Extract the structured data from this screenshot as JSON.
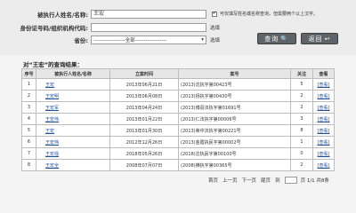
{
  "form": {
    "name_label": "被执行人姓名/名称:",
    "name_value": "王宏",
    "id_label": "身份证号码/组织机构代码:",
    "id_value": "",
    "id_hint": "选填",
    "province_label": "省份:",
    "province_value": "------------------全部------------------",
    "province_hint": "选填",
    "checkbox_mark": "✔",
    "checkbox_text": "可仅填写姓名或名称查询，但需要两个以上汉字。"
  },
  "buttons": {
    "search_label": "查询",
    "search_glyph": "🔍",
    "back_label": "返回",
    "back_glyph": "↩"
  },
  "results": {
    "title": "对“王宏”的查询结果：",
    "headers": [
      "序号",
      "被执行人姓名/名称",
      "立案时间",
      "案号",
      "关注",
      "查看"
    ],
    "rows": [
      [
        "1",
        "王宏",
        "2013年06月21日",
        "(2013)沈执字第00423号",
        "5",
        "[查看]"
      ],
      [
        "2",
        "王宏明",
        "2013年06月08日",
        "(2013)扬执字第00430号",
        "2",
        "[查看]"
      ],
      [
        "3",
        "王宏军",
        "2013年04月24日",
        "(2013)博县法执字第01691号",
        "2",
        "[查看]"
      ],
      [
        "4",
        "王宏伟",
        "2013年01月22日",
        "(2013)仁法执字第00006号",
        "3",
        "[查看]"
      ],
      [
        "5",
        "王宏",
        "2013年01月30日",
        "(2013)荣中法执字第00221号",
        "8",
        "[查看]"
      ],
      [
        "6",
        "王宏伟",
        "2012年12月26日",
        "(2013)金霞执民字第00002号",
        "1",
        "[查看]"
      ],
      [
        "7",
        "王宏强",
        "2018年05月26日",
        "(2018)沈执民字第00100号",
        "0",
        "[查看]"
      ],
      [
        "8",
        "王宏全",
        "2008年07月07日",
        "(2008)横执字第00365号",
        "2",
        "[查看]"
      ]
    ]
  },
  "pager": {
    "first": "首页",
    "prev": "上一页",
    "next": "下一页",
    "last": "尾页",
    "go": "到",
    "page_info": "页 1/1 共8条"
  }
}
